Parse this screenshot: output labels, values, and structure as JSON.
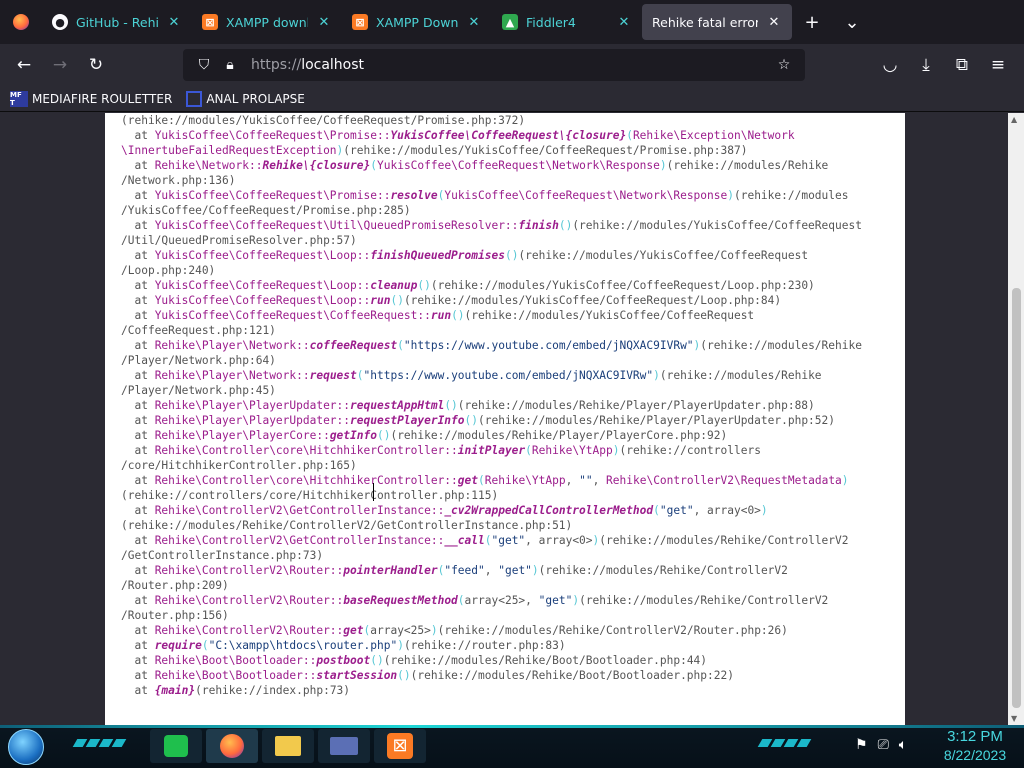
{
  "browser": {
    "tabs": [
      {
        "label": "GitHub - Rehike/",
        "favicon": "github-icon",
        "style": "teal"
      },
      {
        "label": "XAMPP downloa",
        "favicon": "xampp-icon",
        "style": "teal"
      },
      {
        "label": "XAMPP Downloa",
        "favicon": "xampp-icon",
        "style": "teal"
      },
      {
        "label": "Fiddler4",
        "favicon": "fiddler-icon",
        "style": "teal"
      },
      {
        "label": "Rehike fatal error",
        "favicon": "",
        "style": "active"
      }
    ],
    "url_scheme": "https://",
    "url_host": "localhost",
    "bookmarks": [
      {
        "label": "MEDIAFIRE ROULETTER",
        "icon_text": "MF T"
      },
      {
        "label": "ANAL PROLAPSE",
        "icon_text": ""
      }
    ]
  },
  "trace_lines": [
    [
      [
        "g",
        "(rehike://modules/YukisCoffee/CoffeeRequest/Promise.php:372)"
      ]
    ],
    [
      [
        "g",
        "  at "
      ],
      [
        "c",
        "YukisCoffee\\CoffeeRequest\\Promise::"
      ],
      [
        "f",
        "YukisCoffee\\CoffeeRequest\\{closure}"
      ],
      [
        "p",
        "("
      ],
      [
        "c",
        "Rehike\\Exception\\Network"
      ]
    ],
    [
      [
        "c",
        "\\InnertubeFailedRequestException"
      ],
      [
        "p",
        ")"
      ],
      [
        "g",
        "(rehike://modules/YukisCoffee/CoffeeRequest/Promise.php:387)"
      ]
    ],
    [
      [
        "g",
        "  at "
      ],
      [
        "c",
        "Rehike\\Network::"
      ],
      [
        "f",
        "Rehike\\{closure}"
      ],
      [
        "p",
        "("
      ],
      [
        "c",
        "YukisCoffee\\CoffeeRequest\\Network\\Response"
      ],
      [
        "p",
        ")"
      ],
      [
        "g",
        "(rehike://modules/Rehike"
      ]
    ],
    [
      [
        "g",
        "/Network.php:136)"
      ]
    ],
    [
      [
        "g",
        "  at "
      ],
      [
        "c",
        "YukisCoffee\\CoffeeRequest\\Promise::"
      ],
      [
        "f",
        "resolve"
      ],
      [
        "p",
        "("
      ],
      [
        "c",
        "YukisCoffee\\CoffeeRequest\\Network\\Response"
      ],
      [
        "p",
        ")"
      ],
      [
        "g",
        "(rehike://modules"
      ]
    ],
    [
      [
        "g",
        "/YukisCoffee/CoffeeRequest/Promise.php:285)"
      ]
    ],
    [
      [
        "g",
        "  at "
      ],
      [
        "c",
        "YukisCoffee\\CoffeeRequest\\Util\\QueuedPromiseResolver::"
      ],
      [
        "f",
        "finish"
      ],
      [
        "p",
        "()"
      ],
      [
        "g",
        "(rehike://modules/YukisCoffee/CoffeeRequest"
      ]
    ],
    [
      [
        "g",
        "/Util/QueuedPromiseResolver.php:57)"
      ]
    ],
    [
      [
        "g",
        "  at "
      ],
      [
        "c",
        "YukisCoffee\\CoffeeRequest\\Loop::"
      ],
      [
        "f",
        "finishQueuedPromises"
      ],
      [
        "p",
        "()"
      ],
      [
        "g",
        "(rehike://modules/YukisCoffee/CoffeeRequest"
      ]
    ],
    [
      [
        "g",
        "/Loop.php:240)"
      ]
    ],
    [
      [
        "g",
        "  at "
      ],
      [
        "c",
        "YukisCoffee\\CoffeeRequest\\Loop::"
      ],
      [
        "f",
        "cleanup"
      ],
      [
        "p",
        "()"
      ],
      [
        "g",
        "(rehike://modules/YukisCoffee/CoffeeRequest/Loop.php:230)"
      ]
    ],
    [
      [
        "g",
        "  at "
      ],
      [
        "c",
        "YukisCoffee\\CoffeeRequest\\Loop::"
      ],
      [
        "f",
        "run"
      ],
      [
        "p",
        "()"
      ],
      [
        "g",
        "(rehike://modules/YukisCoffee/CoffeeRequest/Loop.php:84)"
      ]
    ],
    [
      [
        "g",
        "  at "
      ],
      [
        "c",
        "YukisCoffee\\CoffeeRequest\\CoffeeRequest::"
      ],
      [
        "f",
        "run"
      ],
      [
        "p",
        "()"
      ],
      [
        "g",
        "(rehike://modules/YukisCoffee/CoffeeRequest"
      ]
    ],
    [
      [
        "g",
        "/CoffeeRequest.php:121)"
      ]
    ],
    [
      [
        "g",
        "  at "
      ],
      [
        "c",
        "Rehike\\Player\\Network::"
      ],
      [
        "f",
        "coffeeRequest"
      ],
      [
        "p",
        "("
      ],
      [
        "s",
        "\"https://www.youtube.com/embed/jNQXAC9IVRw\""
      ],
      [
        "p",
        ")"
      ],
      [
        "g",
        "(rehike://modules/Rehike"
      ]
    ],
    [
      [
        "g",
        "/Player/Network.php:64)"
      ]
    ],
    [
      [
        "g",
        "  at "
      ],
      [
        "c",
        "Rehike\\Player\\Network::"
      ],
      [
        "f",
        "request"
      ],
      [
        "p",
        "("
      ],
      [
        "s",
        "\"https://www.youtube.com/embed/jNQXAC9IVRw\""
      ],
      [
        "p",
        ")"
      ],
      [
        "g",
        "(rehike://modules/Rehike"
      ]
    ],
    [
      [
        "g",
        "/Player/Network.php:45)"
      ]
    ],
    [
      [
        "g",
        "  at "
      ],
      [
        "c",
        "Rehike\\Player\\PlayerUpdater::"
      ],
      [
        "f",
        "requestAppHtml"
      ],
      [
        "p",
        "()"
      ],
      [
        "g",
        "(rehike://modules/Rehike/Player/PlayerUpdater.php:88)"
      ]
    ],
    [
      [
        "g",
        "  at "
      ],
      [
        "c",
        "Rehike\\Player\\PlayerUpdater::"
      ],
      [
        "f",
        "requestPlayerInfo"
      ],
      [
        "p",
        "()"
      ],
      [
        "g",
        "(rehike://modules/Rehike/Player/PlayerUpdater.php:52)"
      ]
    ],
    [
      [
        "g",
        "  at "
      ],
      [
        "c",
        "Rehike\\Player\\PlayerCore::"
      ],
      [
        "f",
        "getInfo"
      ],
      [
        "p",
        "()"
      ],
      [
        "g",
        "(rehike://modules/Rehike/Player/PlayerCore.php:92)"
      ]
    ],
    [
      [
        "g",
        "  at "
      ],
      [
        "c",
        "Rehike\\Controller\\core\\HitchhikerController::"
      ],
      [
        "f",
        "initPlayer"
      ],
      [
        "p",
        "("
      ],
      [
        "c",
        "Rehike\\YtApp"
      ],
      [
        "p",
        ")"
      ],
      [
        "g",
        "(rehike://controllers"
      ]
    ],
    [
      [
        "g",
        "/core/HitchhikerController.php:165)"
      ]
    ],
    [
      [
        "g",
        "  at "
      ],
      [
        "c",
        "Rehike\\Controller\\core\\HitchhikerController::"
      ],
      [
        "f",
        "get"
      ],
      [
        "p",
        "("
      ],
      [
        "c",
        "Rehike\\YtApp"
      ],
      [
        "g",
        ", "
      ],
      [
        "s",
        "\"\""
      ],
      [
        "g",
        ", "
      ],
      [
        "c",
        "Rehike\\ControllerV2\\RequestMetadata"
      ],
      [
        "p",
        ")"
      ]
    ],
    [
      [
        "g",
        "(rehike://controllers/core/HitchhikerController.php:115)"
      ]
    ],
    [
      [
        "g",
        "  at "
      ],
      [
        "c",
        "Rehike\\ControllerV2\\GetControllerInstance::"
      ],
      [
        "f",
        "_cv2WrappedCallControllerMethod"
      ],
      [
        "p",
        "("
      ],
      [
        "s",
        "\"get\""
      ],
      [
        "g",
        ", array<0>"
      ],
      [
        "p",
        ")"
      ]
    ],
    [
      [
        "g",
        "(rehike://modules/Rehike/ControllerV2/GetControllerInstance.php:51)"
      ]
    ],
    [
      [
        "g",
        "  at "
      ],
      [
        "c",
        "Rehike\\ControllerV2\\GetControllerInstance::"
      ],
      [
        "f",
        "__call"
      ],
      [
        "p",
        "("
      ],
      [
        "s",
        "\"get\""
      ],
      [
        "g",
        ", array<0>"
      ],
      [
        "p",
        ")"
      ],
      [
        "g",
        "(rehike://modules/Rehike/ControllerV2"
      ]
    ],
    [
      [
        "g",
        "/GetControllerInstance.php:73)"
      ]
    ],
    [
      [
        "g",
        "  at "
      ],
      [
        "c",
        "Rehike\\ControllerV2\\Router::"
      ],
      [
        "f",
        "pointerHandler"
      ],
      [
        "p",
        "("
      ],
      [
        "s",
        "\"feed\""
      ],
      [
        "g",
        ", "
      ],
      [
        "s",
        "\"get\""
      ],
      [
        "p",
        ")"
      ],
      [
        "g",
        "(rehike://modules/Rehike/ControllerV2"
      ]
    ],
    [
      [
        "g",
        "/Router.php:209)"
      ]
    ],
    [
      [
        "g",
        "  at "
      ],
      [
        "c",
        "Rehike\\ControllerV2\\Router::"
      ],
      [
        "f",
        "baseRequestMethod"
      ],
      [
        "p",
        "("
      ],
      [
        "g",
        "array<25>, "
      ],
      [
        "s",
        "\"get\""
      ],
      [
        "p",
        ")"
      ],
      [
        "g",
        "(rehike://modules/Rehike/ControllerV2"
      ]
    ],
    [
      [
        "g",
        "/Router.php:156)"
      ]
    ],
    [
      [
        "g",
        "  at "
      ],
      [
        "c",
        "Rehike\\ControllerV2\\Router::"
      ],
      [
        "f",
        "get"
      ],
      [
        "p",
        "("
      ],
      [
        "g",
        "array<25>"
      ],
      [
        "p",
        ")"
      ],
      [
        "g",
        "(rehike://modules/Rehike/ControllerV2/Router.php:26)"
      ]
    ],
    [
      [
        "g",
        "  at "
      ],
      [
        "f",
        "require"
      ],
      [
        "p",
        "("
      ],
      [
        "s",
        "\"C:\\xampp\\htdocs\\router.php\""
      ],
      [
        "p",
        ")"
      ],
      [
        "g",
        "(rehike://router.php:83)"
      ]
    ],
    [
      [
        "g",
        "  at "
      ],
      [
        "c",
        "Rehike\\Boot\\Bootloader::"
      ],
      [
        "f",
        "postboot"
      ],
      [
        "p",
        "()"
      ],
      [
        "g",
        "(rehike://modules/Rehike/Boot/Bootloader.php:44)"
      ]
    ],
    [
      [
        "g",
        "  at "
      ],
      [
        "c",
        "Rehike\\Boot\\Bootloader::"
      ],
      [
        "f",
        "startSession"
      ],
      [
        "p",
        "()"
      ],
      [
        "g",
        "(rehike://modules/Rehike/Boot/Bootloader.php:22)"
      ]
    ],
    [
      [
        "g",
        "  at "
      ],
      [
        "f",
        "{main}"
      ],
      [
        "g",
        "(rehike://index.php:73)"
      ]
    ]
  ],
  "taskbar": {
    "time": "3:12 PM",
    "date": "8/22/2023"
  },
  "colors": {
    "class": "#9b1d8c",
    "string": "#1a3e7a",
    "paren": "#57c7d4",
    "tab_teal": "#4cd3d6",
    "clock": "#48d7df"
  }
}
